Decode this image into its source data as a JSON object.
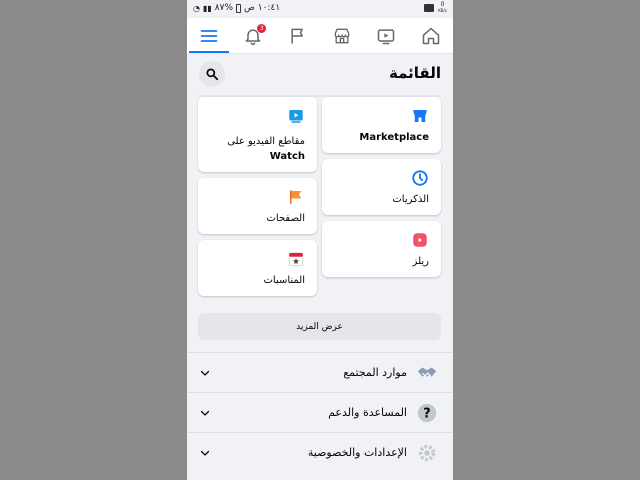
{
  "status_bar": {
    "time": "١٠:٤١ ص",
    "battery": "%٨٧",
    "network_speed": "0",
    "network_unit": "KB/s"
  },
  "tabs": [
    {
      "name": "menu",
      "icon": "hamburger-icon",
      "active": true
    },
    {
      "name": "notifications",
      "icon": "bell-icon",
      "badge": "3"
    },
    {
      "name": "pages",
      "icon": "flag-icon"
    },
    {
      "name": "marketplace",
      "icon": "store-icon"
    },
    {
      "name": "watch",
      "icon": "video-icon"
    },
    {
      "name": "home",
      "icon": "home-icon"
    }
  ],
  "header": {
    "title": "القائمة"
  },
  "shortcuts": {
    "marketplace": "Marketplace",
    "watch_line1": "مقاطع الفيديو على",
    "watch_line2": "Watch",
    "memories": "الذكريات",
    "pages": "الصفحات",
    "reels": "ريلز",
    "events": "المناسبات"
  },
  "see_more": "عرض المزيد",
  "sections": [
    {
      "label": "موارد المجتمع",
      "icon": "handshake-icon"
    },
    {
      "label": "المساعدة والدعم",
      "icon": "help-icon"
    },
    {
      "label": "الإعدادات والخصوصية",
      "icon": "gear-icon"
    }
  ],
  "colors": {
    "accent": "#1877f2",
    "badge": "#e41e3f",
    "background": "#f0f2f5"
  }
}
